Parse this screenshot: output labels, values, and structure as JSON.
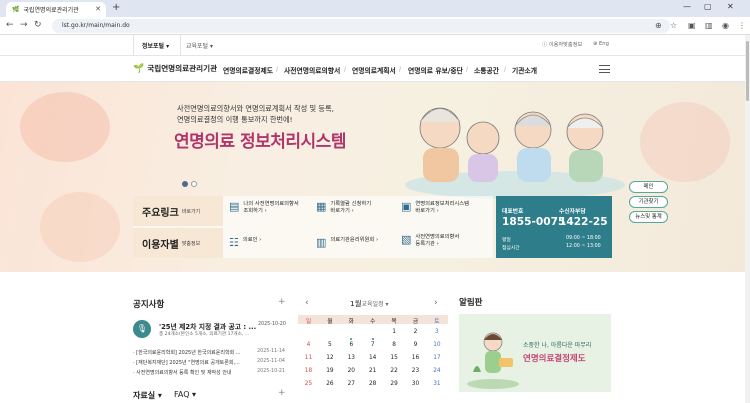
{
  "browser": {
    "tab_title": "국립연명의료관리기관",
    "new_tab": "+",
    "url": "lst.go.kr/main/main.do"
  },
  "util": {
    "info_portal": "정보포털 ▾",
    "edu_portal": "교육포털 ▾",
    "friendly": "이용자맞춤정보",
    "eng": "Eng"
  },
  "gnb": {
    "logo": "국립연명의료관리기관",
    "menus": [
      "연명의료결정제도",
      "사전연명의료의향서",
      "연명의료계획서",
      "연명의료 유보/중단",
      "소통공간",
      "기관소개"
    ]
  },
  "hero": {
    "line1": "사전연명의료의향서와 연명의료계획서 작성 및 등록,",
    "line2": "연명의료결정의 이행 통보까지 한번에!",
    "title": "연명의료 정보처리시스템"
  },
  "side_buttons": [
    "메인",
    "기관찾기",
    "뉴스및 통계"
  ],
  "quick": {
    "head1": "주요링크",
    "head1_sub": "바로가기",
    "items1": [
      {
        "line1": "나의 사전연명의료의향서",
        "line2": "조회하기 ›"
      },
      {
        "line1": "기록열람 신청하기",
        "line2": "바로가기 ›"
      },
      {
        "line1": "연명의료정보처리시스템",
        "line2": "바로가기 ›"
      }
    ],
    "head2": "이용자별",
    "head2_sub": "맞춤정보",
    "items2": [
      {
        "line1": "의료인 ›",
        "line2": ""
      },
      {
        "line1": "의료기관윤리위원회 ›",
        "line2": ""
      },
      {
        "line1": "사전연명의료의향서",
        "line2": "등록기관 ›"
      }
    ]
  },
  "call": {
    "rep_label": "대표번호",
    "rep_num": "1855-0075",
    "fee_label": "수신자부담",
    "fee_num": "1422-25",
    "weekday": "평일",
    "lunch": "점심시간",
    "hours": "09:00 ~ 18:00",
    "lunch_hours": "12:00 ~ 13:00"
  },
  "notice": {
    "title": "공지사항",
    "featured_title": "'25년 제2차 지정 결과 공고 : ...",
    "featured_sub": "총 24개소(본인소 5개소, 의료기관 17개소, ...",
    "featured_date": "2025-10-20",
    "items": [
      {
        "text": "· [한국의료윤리학회] 2025년 한국의료윤리학회 ...",
        "date": "2025-11-14"
      },
      {
        "text": "· [재단복지재단] 2025년 \"연명의료 공개토론회,...",
        "date": "2025-11-04"
      },
      {
        "text": "· 사전연명의료의향서 등록 확인 및 재작성 안내",
        "date": "2025-10-21"
      }
    ]
  },
  "calendar": {
    "month": "1월",
    "label": "교육일정 ▾",
    "prev": "‹",
    "next": "›",
    "weekdays": [
      "일",
      "월",
      "화",
      "수",
      "목",
      "금",
      "토"
    ],
    "weeks": [
      [
        "",
        "",
        "",
        "",
        "1",
        "2",
        "3"
      ],
      [
        "4",
        "5",
        "6",
        "7",
        "8",
        "9",
        "10"
      ],
      [
        "11",
        "12",
        "13",
        "14",
        "15",
        "16",
        "17"
      ],
      [
        "18",
        "19",
        "20",
        "21",
        "22",
        "23",
        "24"
      ],
      [
        "25",
        "26",
        "27",
        "28",
        "29",
        "30",
        "31"
      ]
    ]
  },
  "alim": {
    "title": "알림판",
    "line1": "소중한 나, 아름다운 마무리",
    "line2": "연명의료결정제도"
  },
  "bottom": {
    "jaryo": "자료실 ▾",
    "faq": "FAQ ▾"
  }
}
